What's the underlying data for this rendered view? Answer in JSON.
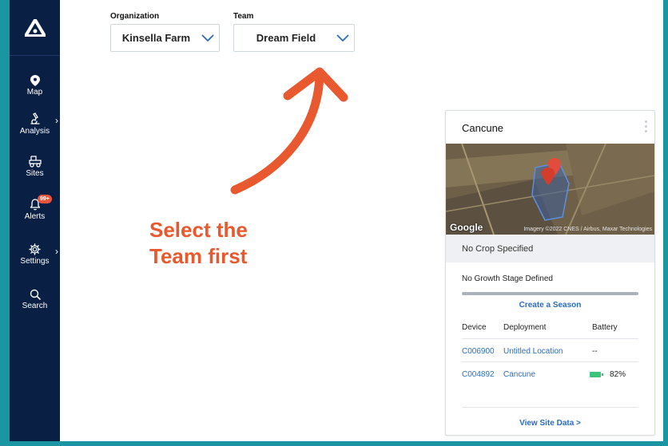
{
  "sidebar": {
    "items": [
      {
        "label": "Map",
        "icon": "map-pin-icon"
      },
      {
        "label": "Analysis",
        "icon": "microscope-icon"
      },
      {
        "label": "Sites",
        "icon": "tractor-icon"
      },
      {
        "label": "Alerts",
        "icon": "bell-icon",
        "badge": "99+"
      },
      {
        "label": "Settings",
        "icon": "gear-icon"
      },
      {
        "label": "Search",
        "icon": "search-icon"
      }
    ]
  },
  "filters": {
    "organization": {
      "label": "Organization",
      "value": "Kinsella Farm"
    },
    "team": {
      "label": "Team",
      "value": "Dream Field"
    }
  },
  "annotation": {
    "line1": "Select the",
    "line2": "Team first"
  },
  "site_card": {
    "title": "Cancune",
    "map": {
      "brand": "Google",
      "attribution": "Imagery ©2022 CNES / Airbus, Maxar Technologies"
    },
    "crop": "No Crop Specified",
    "growth_stage": "No Growth Stage Defined",
    "season_progress": 1.0,
    "create_season": "Create a Season",
    "columns": [
      "Device",
      "Deployment",
      "Battery"
    ],
    "rows": [
      {
        "device": "C006900",
        "deployment": "Untitled Location",
        "battery": "--"
      },
      {
        "device": "C004892",
        "deployment": "Cancune",
        "battery": "82%"
      }
    ],
    "view_link": "View Site Data >"
  },
  "colors": {
    "sidebar": "#0a1f44",
    "accent": "#e8592f",
    "link": "#2a6cc2",
    "battery": "#3cc47c",
    "frame": "#1a96a3"
  }
}
